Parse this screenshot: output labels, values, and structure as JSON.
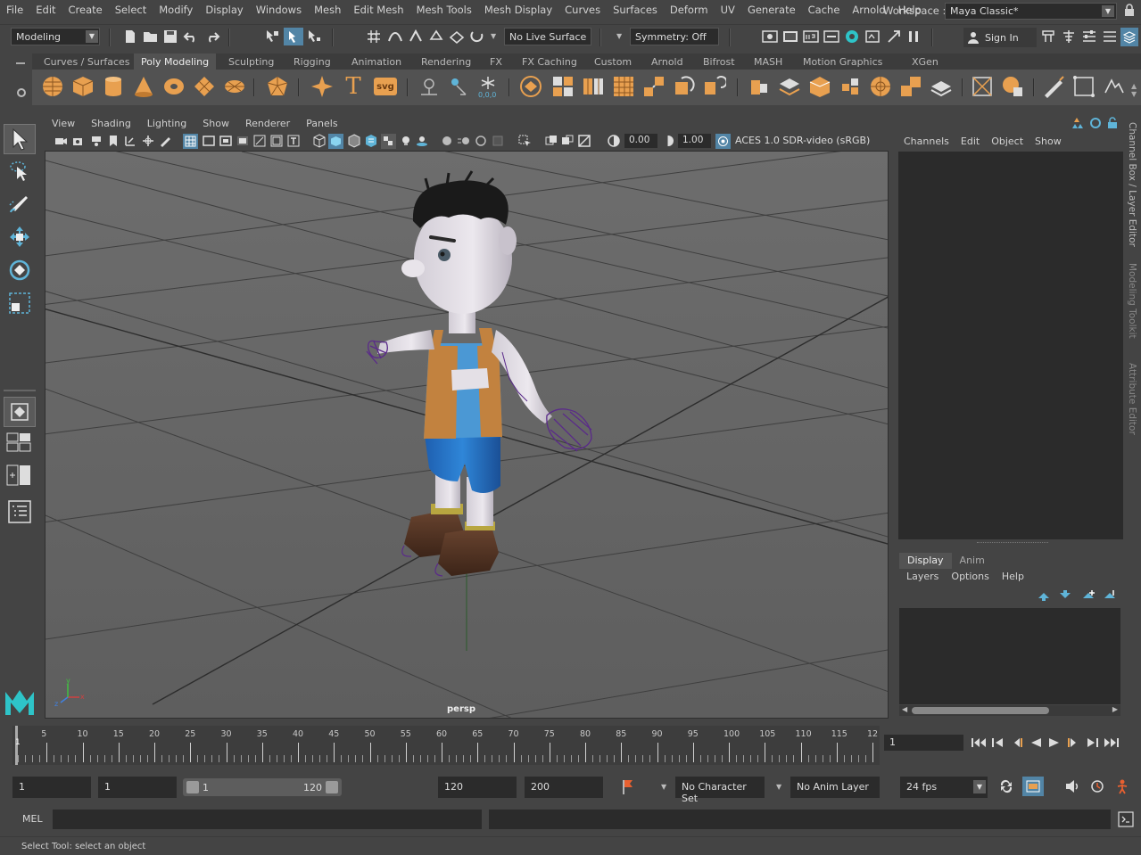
{
  "menubar": {
    "items": [
      "File",
      "Edit",
      "Create",
      "Select",
      "Modify",
      "Display",
      "Windows",
      "Mesh",
      "Edit Mesh",
      "Mesh Tools",
      "Mesh Display",
      "Curves",
      "Surfaces",
      "Deform",
      "UV",
      "Generate",
      "Cache",
      "Arnold",
      "Help"
    ],
    "workspace_label": "Workspace :",
    "workspace_value": "Maya Classic*"
  },
  "statusline": {
    "mode": "Modeling",
    "live_surface": "No Live Surface",
    "symmetry": "Symmetry: Off",
    "sign_in": "Sign In"
  },
  "shelf": {
    "tabs": [
      "Curves / Surfaces",
      "Poly Modeling",
      "Sculpting",
      "Rigging",
      "Animation",
      "Rendering",
      "FX",
      "FX Caching",
      "Custom",
      "Arnold",
      "Bifrost",
      "MASH",
      "Motion Graphics",
      "XGen"
    ],
    "active_tab": "Poly Modeling",
    "text_icon": "T",
    "svg_icon": "svg"
  },
  "viewport": {
    "menu": [
      "View",
      "Shading",
      "Lighting",
      "Show",
      "Renderer",
      "Panels"
    ],
    "exposure": "0.00",
    "gamma": "1.00",
    "color_space": "ACES 1.0 SDR-video (sRGB)",
    "camera_label": "persp",
    "axis_labels": {
      "x": "x",
      "y": "y",
      "z": "z"
    }
  },
  "channel_box": {
    "menu": [
      "Channels",
      "Edit",
      "Object",
      "Show"
    ]
  },
  "layer_editor": {
    "tabs": [
      "Display",
      "Anim"
    ],
    "active_tab": "Display",
    "menu": [
      "Layers",
      "Options",
      "Help"
    ]
  },
  "side_tabs": [
    "Channel Box / Layer Editor",
    "Modeling Toolkit",
    "Attribute Editor"
  ],
  "timeslider": {
    "ticks": [
      "5",
      "10",
      "15",
      "20",
      "25",
      "30",
      "35",
      "40",
      "45",
      "50",
      "55",
      "60",
      "65",
      "70",
      "75",
      "80",
      "85",
      "90",
      "95",
      "100",
      "105",
      "110",
      "115",
      "12"
    ],
    "current_marker": "1",
    "current_frame": "1"
  },
  "range": {
    "start": "1",
    "playback_start": "1",
    "slider_start": "1",
    "slider_end": "120",
    "playback_end": "120",
    "end": "200",
    "character_set": "No Character Set",
    "anim_layer": "No Anim Layer",
    "fps": "24 fps"
  },
  "command": {
    "label": "MEL"
  },
  "help_line": "Select Tool: select an object",
  "colors": {
    "accent_blue": "#5285a6",
    "shelf_orange": "#e8a050",
    "maya_logo": "#2ec4c8",
    "viewport_bg": "#7a7a7a"
  }
}
